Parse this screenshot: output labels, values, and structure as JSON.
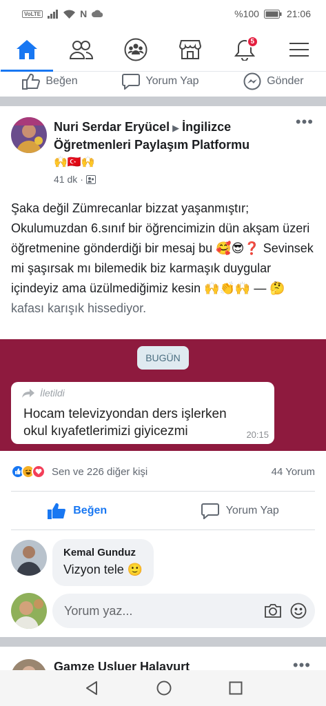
{
  "status_bar": {
    "volte": "VoLTE",
    "battery_pct": "%100",
    "time": "21:06"
  },
  "nav": {
    "items": [
      "home-icon",
      "friends-icon",
      "groups-icon",
      "marketplace-icon",
      "notifications-icon",
      "menu-icon"
    ],
    "notifications_badge": "5",
    "accent": "#1877f2"
  },
  "prev_post_actions": {
    "like": "Beğen",
    "comment": "Yorum Yap",
    "send": "Gönder"
  },
  "post": {
    "author": "Nuri Serdar Eryücel",
    "group": "İngilizce Öğretmenleri Paylaşım Platformu",
    "group_emoji": "🙌🇹🇷🙌",
    "time": "41 dk",
    "text": "Şaka değil Zümrecanlar bizzat yaşanmıştır; Okulumuzdan 6.sınıf bir öğrencimizin dün akşam üzeri öğretmenine gönderdiği bir mesaj bu 🥰😎❓ Sevinsek mi şaşırsak mı bilemedik biz karmaşık duygular içindeyiz ama üzülmediğimiz kesin 🙌👏🙌 — 🤔",
    "feeling": "kafası karışık hissediyor.",
    "image": {
      "date_pill": "BUGÜN",
      "forwarded_label": "İletildi",
      "message": "Hocam televizyondan ders işlerken okul kıyafetlerimizi giyicezmi",
      "message_time": "20:15",
      "background": "#8e1a3e"
    },
    "reactions_summary": "Sen ve 226 diğer kişi",
    "comments_count": "44 Yorum",
    "like_label": "Beğen",
    "comment_label": "Yorum Yap"
  },
  "comment": {
    "author": "Kemal Gunduz",
    "text": "Vizyon tele 🙂"
  },
  "composer": {
    "placeholder": "Yorum yaz..."
  },
  "next_post": {
    "author": "Gamze Usluer Halavurt"
  }
}
